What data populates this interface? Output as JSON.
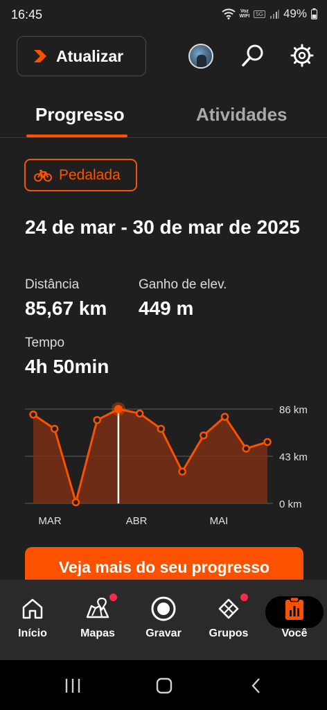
{
  "status": {
    "time": "16:45",
    "volte_top": "Voz",
    "volte_bottom": "WIFI",
    "network_badge": "5G",
    "battery": "49%"
  },
  "header": {
    "refresh_label": "Atualizar"
  },
  "tabs": [
    {
      "label": "Progresso",
      "active": true
    },
    {
      "label": "Atividades",
      "active": false
    }
  ],
  "sport": {
    "label": "Pedalada",
    "icon": "bike-icon"
  },
  "summary": {
    "date_range": "24 de mar - 30 de mar de 2025",
    "distance": {
      "label": "Distância",
      "value": "85,67 km"
    },
    "elevation": {
      "label": "Ganho de elev.",
      "value": "449 m"
    },
    "time": {
      "label": "Tempo",
      "value": "4h 50min"
    }
  },
  "chart_data": {
    "type": "area",
    "x_tick_labels": [
      "MAR",
      "ABR",
      "MAI"
    ],
    "y_tick_labels": [
      "86 km",
      "43 km",
      "0 km"
    ],
    "ylim": [
      0,
      86
    ],
    "unit": "km",
    "values": [
      81,
      68,
      1,
      76,
      86,
      82,
      68,
      29,
      62,
      79,
      50,
      56
    ],
    "selected_index": 4,
    "grid": true,
    "color": "#fc5200",
    "fill_color": "#7a2f14"
  },
  "cta": {
    "label": "Veja mais do seu progresso"
  },
  "nav": [
    {
      "label": "Início",
      "icon": "home-icon",
      "dot": false,
      "active": false
    },
    {
      "label": "Mapas",
      "icon": "map-icon",
      "dot": true,
      "active": false
    },
    {
      "label": "Gravar",
      "icon": "record-icon",
      "dot": false,
      "active": false
    },
    {
      "label": "Grupos",
      "icon": "groups-icon",
      "dot": true,
      "active": false
    },
    {
      "label": "Você",
      "icon": "you-icon",
      "dot": false,
      "active": true
    }
  ],
  "colors": {
    "accent": "#fc5200",
    "background": "#1f1f1f",
    "notification": "#fc2a4a"
  }
}
